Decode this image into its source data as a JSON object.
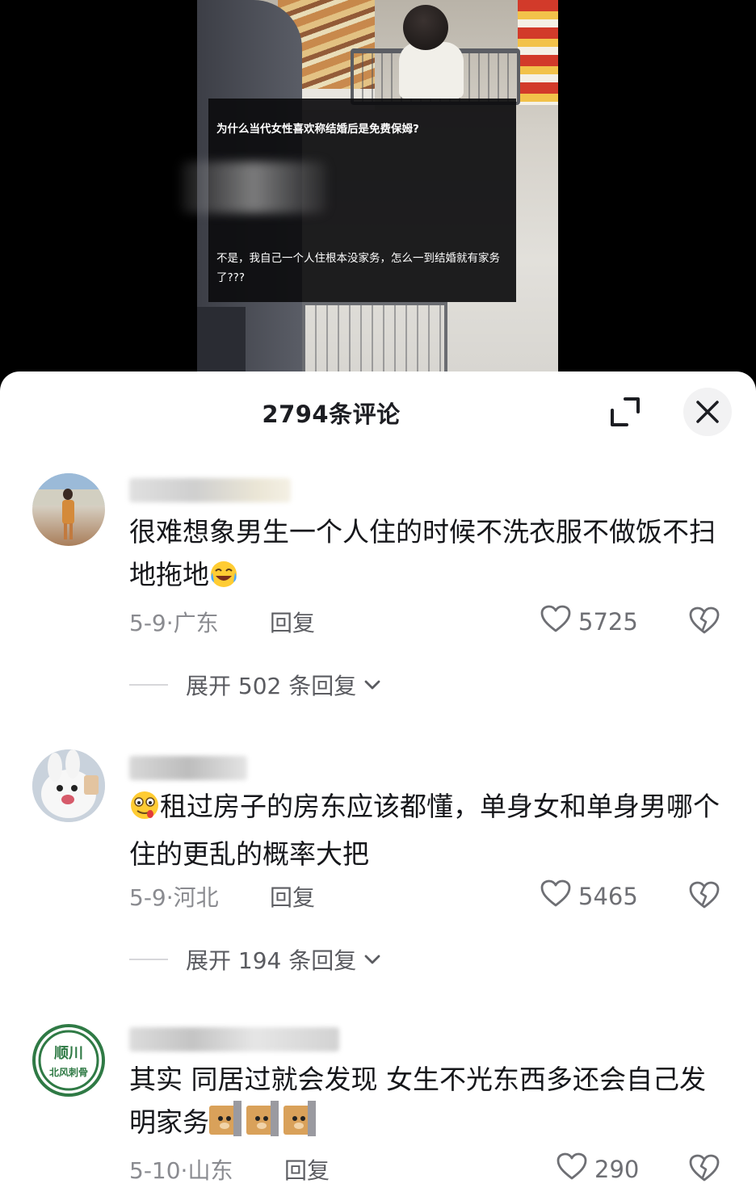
{
  "video": {
    "caption_title": "为什么当代女性喜欢称结婚后是免费保姆?",
    "caption_body": "不是，我自己一个人住根本没家务，怎么一到结婚就有家务了???"
  },
  "sheet": {
    "title": "2794条评论",
    "expand_icon": "expand-icon",
    "close_icon": "close-icon"
  },
  "comments": [
    {
      "text": "很难想象男生一个人住的时候不洗衣服不做饭不扫地拖地",
      "trailing_emoji": "crying-laughing-emoji",
      "date_location": "5-9·广东",
      "reply_label": "回复",
      "likes": "5725",
      "expand_label": "展开 502 条回复"
    },
    {
      "leading_emoji": "drooling-face-emoji",
      "text": "租过房子的房东应该都懂，单身女和单身男哪个住的更乱的概率大把",
      "date_location": "5-9·河北",
      "reply_label": "回复",
      "likes": "5465",
      "expand_label": "展开 194 条回复"
    },
    {
      "text": "其实 同居过就会发现 女生不光东西多还会自己发明家务",
      "trailing_emoji": "doge-wall-emoji",
      "date_location": "5-10·山东",
      "reply_label": "回复",
      "likes": "290",
      "avatar_text": "顺川 北风刺骨"
    }
  ],
  "colors": {
    "sheet_bg": "#ffffff",
    "primary_text": "#16171b",
    "secondary_text": "#8a8b90",
    "accent_green": "#2f7a45"
  }
}
